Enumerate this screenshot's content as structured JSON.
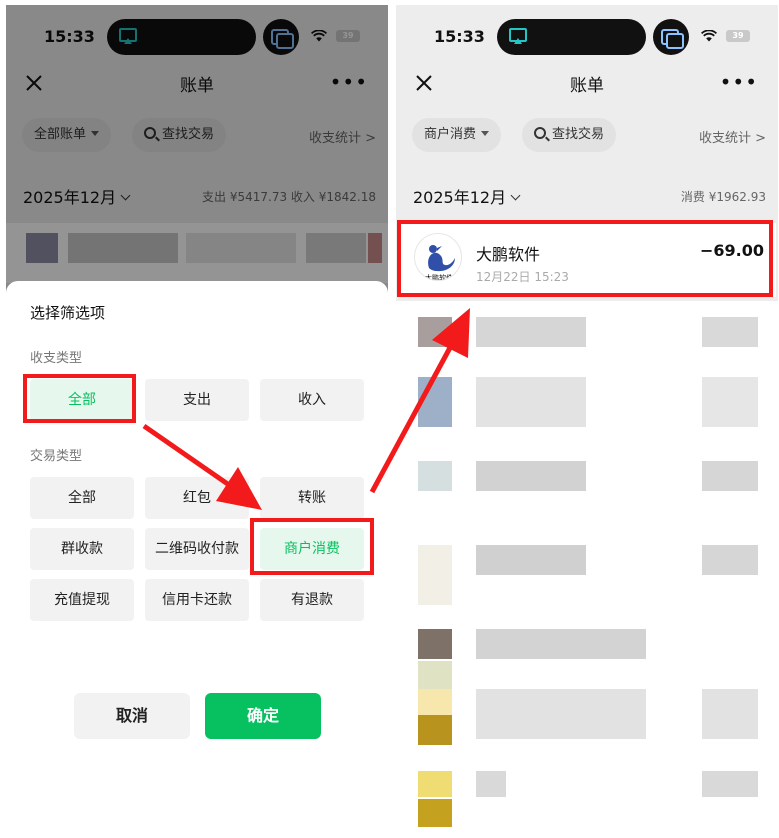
{
  "left": {
    "status": {
      "time": "15:33",
      "battery": "39"
    },
    "nav": {
      "title": "账单"
    },
    "filter": {
      "account_label": "全部账单",
      "search_label": "查找交易",
      "stats_label": "收支统计 >"
    },
    "month": {
      "label": "2025年12月",
      "totals": "支出 ¥5417.73  收入 ¥1842.18"
    },
    "sheet": {
      "title": "选择筛选项",
      "section1": "收支类型",
      "type_options": [
        "全部",
        "支出",
        "收入"
      ],
      "section2": "交易类型",
      "trade_options": [
        "全部",
        "红包",
        "转账",
        "群收款",
        "二维码收付款",
        "商户消费",
        "充值提现",
        "信用卡还款",
        "有退款"
      ],
      "cancel": "取消",
      "confirm": "确定"
    }
  },
  "right": {
    "status": {
      "time": "15:33",
      "battery": "39"
    },
    "nav": {
      "title": "账单"
    },
    "filter": {
      "account_label": "商户消费",
      "search_label": "查找交易",
      "stats_label": "收支统计 >"
    },
    "month": {
      "label": "2025年12月",
      "totals": "消费 ¥1962.93"
    },
    "transaction": {
      "name": "大鹏软件",
      "time": "12月22日 15:23",
      "amount": "−69.00",
      "logo_text": "大鹏软件"
    }
  },
  "colors": {
    "accent": "#07c160",
    "highlight": "#f21a1a"
  }
}
